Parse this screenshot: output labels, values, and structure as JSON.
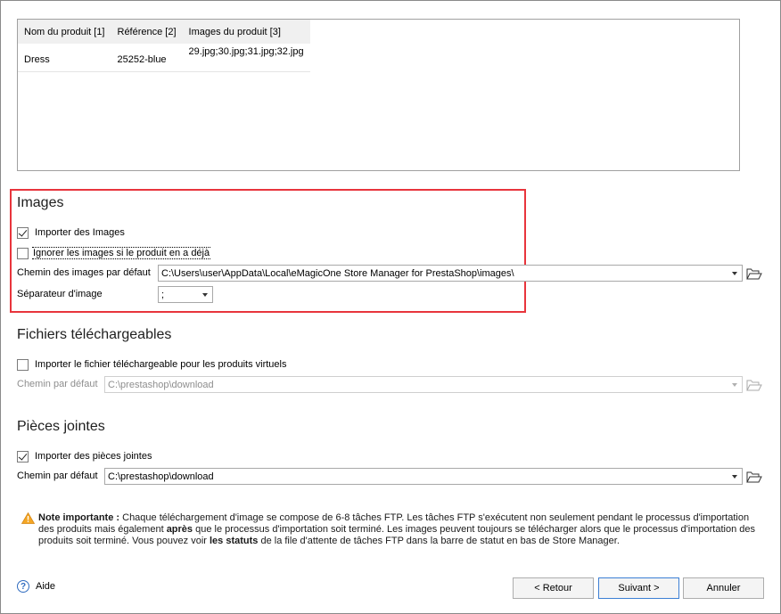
{
  "preview": {
    "columns": [
      "Nom du produit [1]",
      "Référence [2]",
      "Images du produit [3]"
    ],
    "rows": [
      [
        "Dress",
        "25252-blue",
        "29.jpg;30.jpg;31.jpg;32.jpg"
      ]
    ]
  },
  "images": {
    "title": "Images",
    "import_label": "Importer des Images",
    "import_checked": true,
    "ignore_label": "Ignorer les images si le produit en a déjà",
    "ignore_checked": false,
    "path_label": "Chemin des images par défaut",
    "path_value": "C:\\Users\\user\\AppData\\Local\\eMagicOne Store Manager for PrestaShop\\images\\",
    "separator_label": "Séparateur d'image",
    "separator_value": ";"
  },
  "downloads": {
    "title": "Fichiers téléchargeables",
    "import_label": "Importer le fichier téléchargeable pour les produits virtuels",
    "import_checked": false,
    "path_label": "Chemin par défaut",
    "path_value": "C:\\prestashop\\download"
  },
  "attachments": {
    "title": "Pièces jointes",
    "import_label": "Importer des pièces jointes",
    "import_checked": true,
    "path_label": "Chemin par défaut",
    "path_value": "C:\\prestashop\\download"
  },
  "note": {
    "bold_lead": "Note importante :",
    "part1": " Chaque téléchargement d'image se compose de 6-8 tâches FTP. Les tâches FTP s'exécutent non seulement pendant le processus d'importation des produits mais également ",
    "bold_after": "après",
    "part2": " que le processus d'importation soit terminé. Les images peuvent toujours se télécharger alors que le processus d'importation des produits soit terminé. Vous pouvez voir ",
    "bold_status": "les statuts",
    "part3": " de la file d'attente de tâches FTP dans la barre de statut en bas de Store Manager."
  },
  "footer": {
    "help_label": "Aide",
    "back_label": "< Retour",
    "next_label": "Suivant >",
    "cancel_label": "Annuler"
  },
  "icons": {
    "folder": "folder-open-icon",
    "warning": "warning-icon",
    "help": "help-icon"
  }
}
